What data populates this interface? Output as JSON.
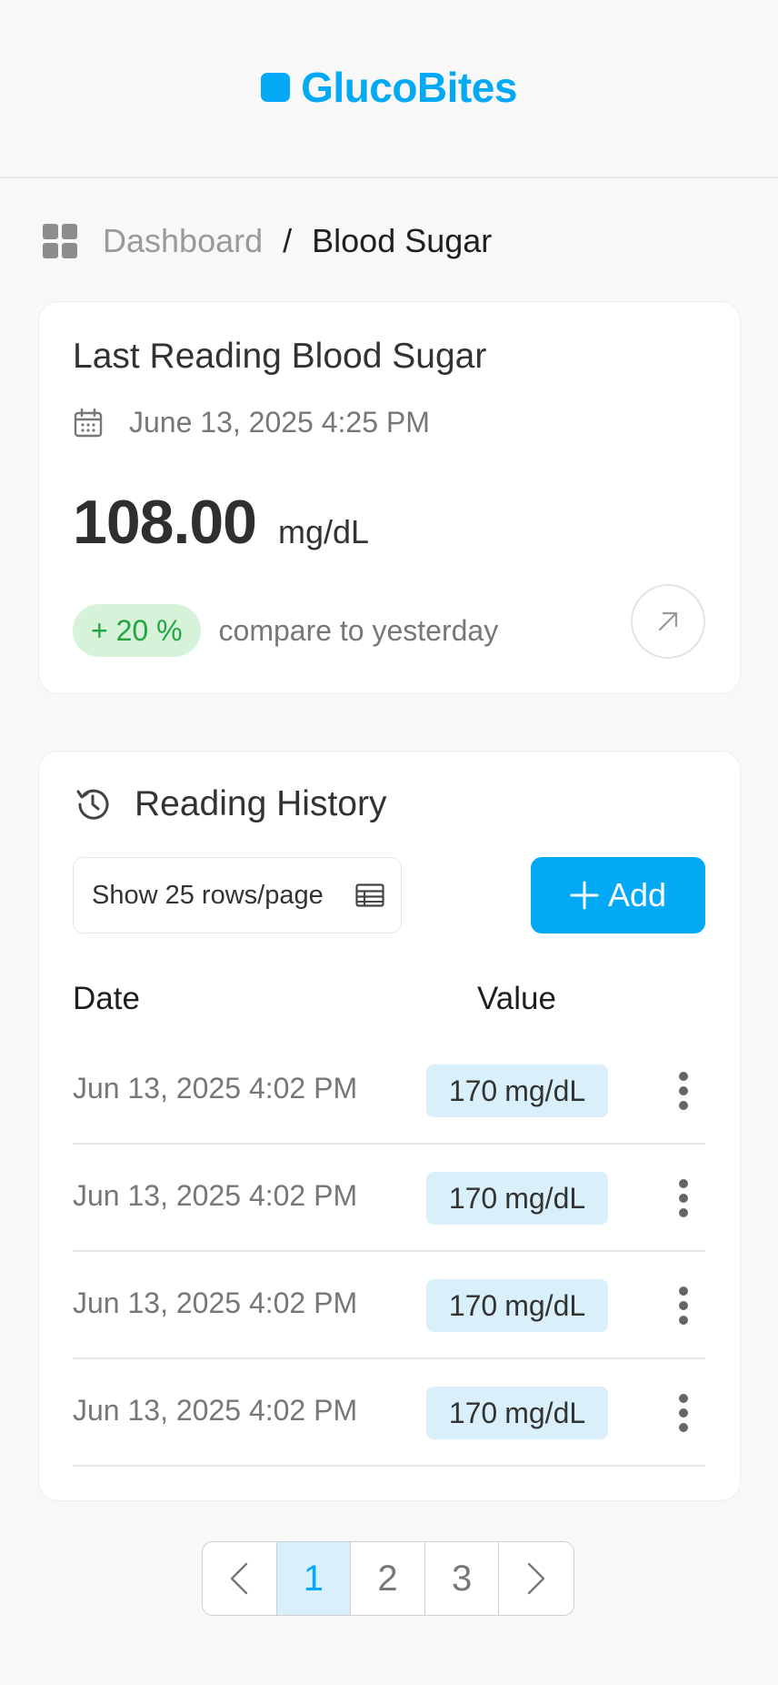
{
  "app": {
    "name": "GlucoBites",
    "brand_color": "#03a9f4"
  },
  "breadcrumb": {
    "home": "Dashboard",
    "separator": "/",
    "current": "Blood Sugar"
  },
  "last_reading": {
    "title": "Last Reading Blood Sugar",
    "datetime": "June 13, 2025 4:25 PM",
    "value": "108.00",
    "unit": "mg/dL",
    "change": "+ 20 %",
    "change_color": "#22a541",
    "compare_text": "compare to yesterday"
  },
  "history": {
    "title": "Reading History",
    "rows_per_page_label": "Show 25 rows/page",
    "add_label": "Add",
    "columns": {
      "date": "Date",
      "value": "Value"
    },
    "rows": [
      {
        "date": "Jun 13, 2025 4:02 PM",
        "value": "170",
        "unit": "mg/dL"
      },
      {
        "date": "Jun 13, 2025 4:02 PM",
        "value": "170",
        "unit": "mg/dL"
      },
      {
        "date": "Jun 13, 2025 4:02 PM",
        "value": "170",
        "unit": "mg/dL"
      },
      {
        "date": "Jun 13, 2025 4:02 PM",
        "value": "170",
        "unit": "mg/dL"
      }
    ]
  },
  "pagination": {
    "pages": [
      "1",
      "2",
      "3"
    ],
    "current": "1"
  }
}
